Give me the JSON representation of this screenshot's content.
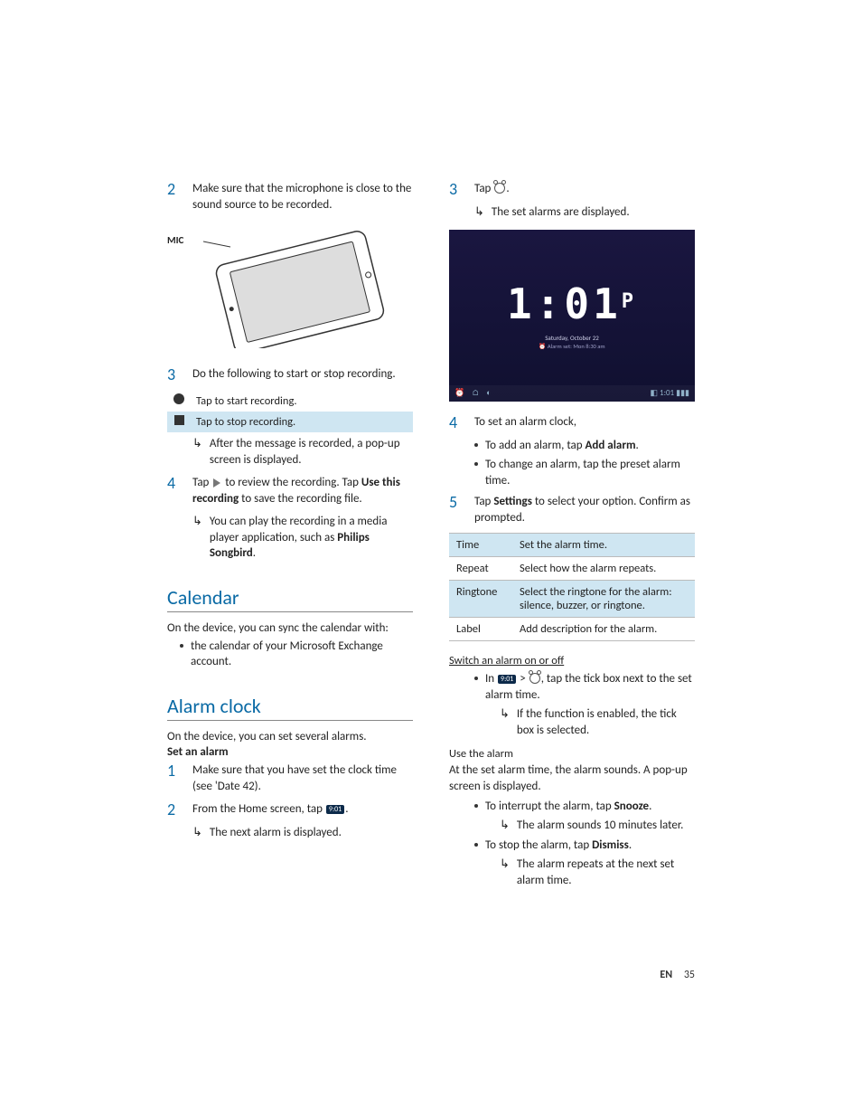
{
  "left": {
    "step2": "Make sure that the microphone is close to the sound source to be recorded.",
    "micLabel": "MIC",
    "step3": "Do the following to start or stop recording.",
    "recTable": {
      "start": "Tap to start recording.",
      "stop": "Tap to stop recording."
    },
    "step3sub": "After the message is recorded, a pop-up screen is displayed.",
    "step4a": "Tap ",
    "step4b": " to review the recording. Tap ",
    "step4bold": "Use this recording",
    "step4c": " to save the recording file.",
    "step4sub_a": "You can play the recording in a media player application, such as ",
    "step4sub_bold": "Philips Songbird",
    "step4sub_b": ".",
    "calendarTitle": "Calendar",
    "calendarIntro": "On the device, you can sync the calendar with:",
    "calendarBullet": "the calendar of your Microsoft Exchange account.",
    "alarmTitle": "Alarm clock",
    "alarmIntro": "On the device, you can set several alarms.",
    "setAlarmHead": "Set an alarm",
    "alarmStep1": "Make sure that you have set the clock time (see 'Date 42).",
    "alarmStep2a": "From the Home screen, tap ",
    "alarmStep2b": ".",
    "alarmStep2sub": "The next alarm is displayed."
  },
  "right": {
    "step3a": "Tap ",
    "step3b": ".",
    "step3sub": "The set alarms are displayed.",
    "clock": {
      "time": "1:01",
      "suffix": "P",
      "date": "Saturday, October 22",
      "alarmText": "⏰ Alarm set: Mon 8:30 am",
      "bottomRight": "◧ 1:01 ▮▮▮"
    },
    "step4": "To set an alarm clock,",
    "step4b1a": "To add an alarm, tap ",
    "step4b1bold": "Add alarm",
    "step4b1b": ".",
    "step4b2": "To change an alarm, tap the preset alarm time.",
    "step5a": "Tap ",
    "step5bold": "Settings",
    "step5b": " to select your option. Confirm as prompted.",
    "optTable": {
      "time": {
        "k": "Time",
        "v": "Set the alarm time."
      },
      "repeat": {
        "k": "Repeat",
        "v": "Select how the alarm repeats."
      },
      "ringtone": {
        "k": "Ringtone",
        "v": "Select the ringtone for the alarm: silence, buzzer, or ringtone."
      },
      "label": {
        "k": "Label",
        "v": "Add description for the alarm."
      }
    },
    "switchHead": "Switch an alarm on or off",
    "switch_a": "In ",
    "switch_b": " > ",
    "switch_c": ", tap the tick box next to the set alarm time.",
    "switchSub": "If the function is enabled, the tick box is selected.",
    "useHead": "Use the alarm",
    "useIntro": "At the set alarm time, the alarm sounds. A pop-up screen is displayed.",
    "use1a": "To interrupt the alarm, tap ",
    "use1bold": "Snooze",
    "use1b": ".",
    "use1sub": "The alarm sounds 10 minutes later.",
    "use2a": "To stop the alarm, tap ",
    "use2bold": "Dismiss",
    "use2b": ".",
    "use2sub": "The alarm repeats at the next set alarm time."
  },
  "footer": {
    "lang": "EN",
    "page": "35"
  }
}
